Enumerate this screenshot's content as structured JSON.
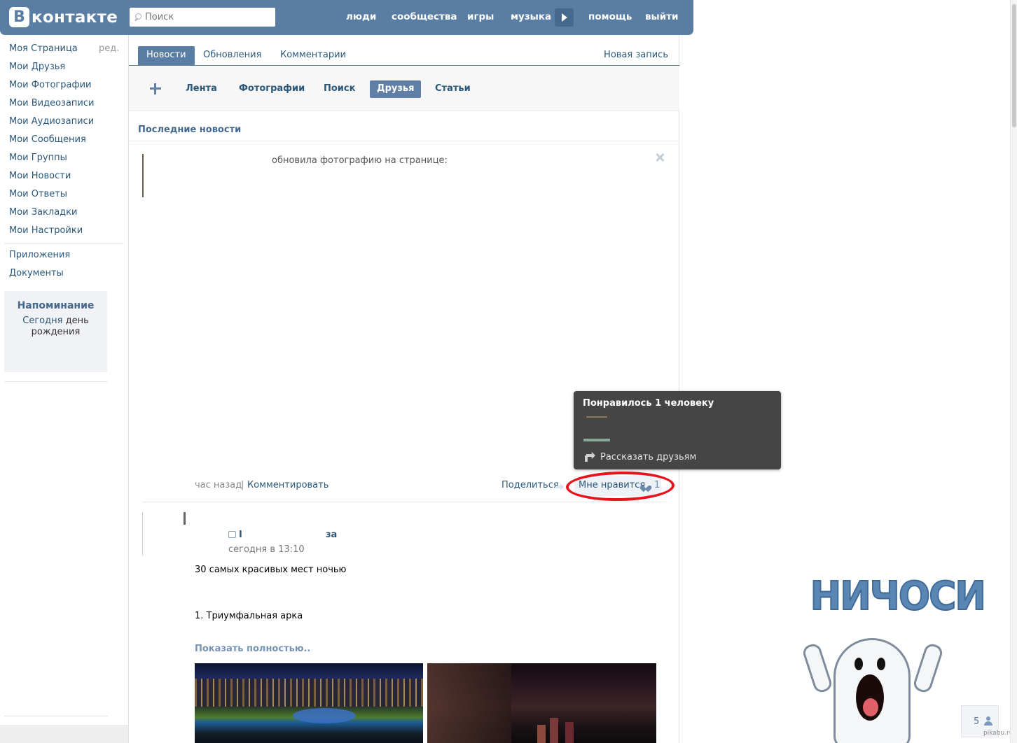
{
  "header": {
    "logo_letter": "В",
    "logo_text": "контакте",
    "search_placeholder": "Поиск",
    "nav": [
      "люди",
      "сообщества",
      "игры",
      "музыка",
      "помощь",
      "выйти"
    ]
  },
  "sidebar": {
    "edit_label": "ред.",
    "items": [
      "Моя Страница",
      "Мои Друзья",
      "Мои Фотографии",
      "Мои Видеозаписи",
      "Мои Аудиозаписи",
      "Мои Сообщения",
      "Мои Группы",
      "Мои Новости",
      "Мои Ответы",
      "Мои Закладки",
      "Мои Настройки"
    ],
    "extra": [
      "Приложения",
      "Документы"
    ],
    "reminder": {
      "title": "Напоминание",
      "today": "Сегодня",
      "text": "день рождения"
    }
  },
  "tabs": {
    "items": [
      "Новости",
      "Обновления",
      "Комментарии"
    ],
    "active": "Новости",
    "new_post": "Новая запись"
  },
  "filters": {
    "items": [
      "Лента",
      "Фотографии",
      "Поиск",
      "Друзья",
      "Статьи"
    ],
    "active": "Друзья"
  },
  "feed": {
    "section_title": "Последние новости",
    "post1": {
      "text": "обновила фотографию на странице:",
      "time": "час назад",
      "separator": "|",
      "comment": "Комментировать",
      "share": "Поделиться",
      "like": "Мне нравится",
      "like_count": "1"
    },
    "post2": {
      "author_start": "I",
      "author_end": "за",
      "date": "сегодня в 13:10",
      "text": "30 самых красивых мест ночью",
      "item": "1. Триумфальная арка",
      "more": "Показать полностью.."
    }
  },
  "tooltip": {
    "title": "Понравилось 1 человеку",
    "tell_friends": "Рассказать друзьям"
  },
  "sticker": {
    "text": "НИЧОСИ"
  },
  "friends_online": {
    "count": "5"
  },
  "watermark": "pikabu.ru",
  "colors": {
    "header_bg": "#597da3",
    "link": "#2b587a",
    "tooltip_bg": "#454545",
    "highlight_circle": "#e8141c"
  }
}
